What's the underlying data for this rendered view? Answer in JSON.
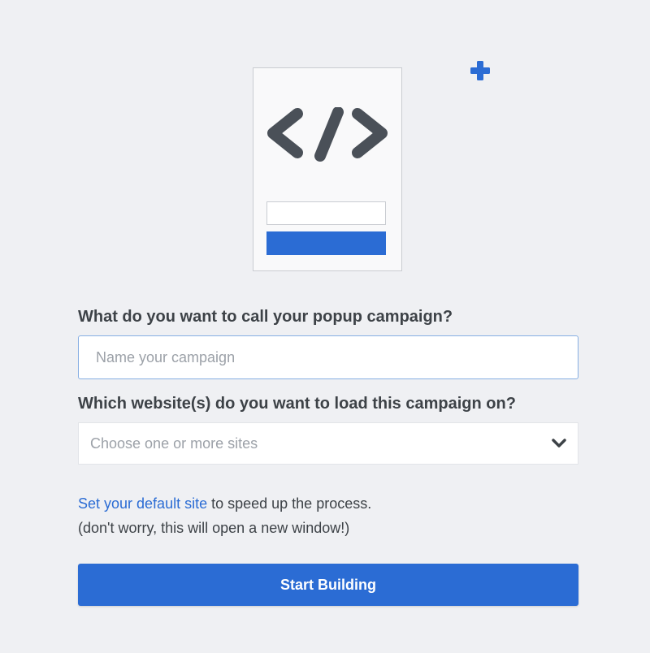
{
  "illustration": {
    "code_icon": "code-brackets-icon",
    "plus_icon": "plus-icon",
    "accent_color": "#2b6cd4",
    "glyph_color": "#4a5058"
  },
  "form": {
    "campaign_question": "What do you want to call your popup campaign?",
    "campaign_name": {
      "value": "",
      "placeholder": "Name your campaign"
    },
    "website_question": "Which website(s) do you want to load this campaign on?",
    "website_select": {
      "placeholder": "Choose one or more sites",
      "icon": "chevron-down-icon"
    },
    "help": {
      "link_text": "Set your default site",
      "text_after_link": " to speed up the process.",
      "note": "(don't worry, this will open a new window!)"
    },
    "submit_label": "Start Building"
  }
}
